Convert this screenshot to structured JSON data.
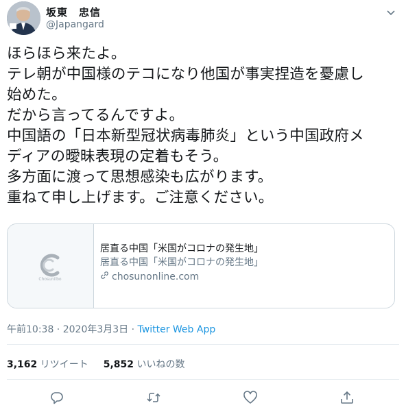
{
  "author": {
    "display_name": "坂東　忠信",
    "handle": "@Japangard"
  },
  "tweet": {
    "lines": [
      "ほらほら来たよ。",
      "テレ朝が中国様のテコになり他国が事実捏造を憂慮し",
      "始めた。",
      "だから言ってるんですよ。",
      "中国語の「日本新型冠状病毒肺炎」という中国政府メ",
      "ディアの曖昧表現の定着もそう。",
      "多方面に渡って思想感染も広がります。",
      "重ねて申し上げます。ご注意ください。"
    ]
  },
  "card": {
    "thumb_brand": "Chosunilbo",
    "title": "居直る中国「米国がコロナの発生地」",
    "description": "居直る中国「米国がコロナの発生地」",
    "domain": "chosunonline.com"
  },
  "meta": {
    "time": "午前10:38",
    "separator": " · ",
    "date": "2020年3月3日",
    "source": "Twitter Web App"
  },
  "stats": {
    "retweets_count": "3,162",
    "retweets_label": "リツイート",
    "likes_count": "5,852",
    "likes_label": "いいねの数"
  },
  "icons": {
    "more": "chevron-down-icon",
    "reply": "reply-icon",
    "retweet": "retweet-icon",
    "like": "heart-icon",
    "share": "share-icon",
    "link": "link-icon"
  },
  "colors": {
    "text": "#14171a",
    "secondary": "#657786",
    "link": "#1b95e0",
    "border": "#ccd6dd"
  }
}
